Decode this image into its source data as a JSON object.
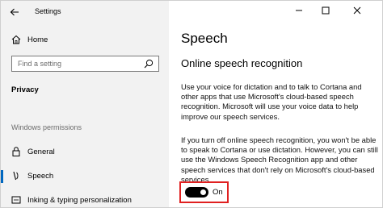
{
  "window": {
    "title": "Settings"
  },
  "sidebar": {
    "home_label": "Home",
    "search_placeholder": "Find a setting",
    "section_title": "Privacy",
    "group_label": "Windows permissions",
    "items": [
      {
        "label": "General",
        "icon": "lock-icon",
        "selected": false
      },
      {
        "label": "Speech",
        "icon": "microphone-icon",
        "selected": true
      },
      {
        "label": "Inking & typing personalization",
        "icon": "pen-icon",
        "selected": false
      }
    ]
  },
  "main": {
    "page_title": "Speech",
    "section_title": "Online speech recognition",
    "paragraph1": "Use your voice for dictation and to talk to Cortana and other apps that use Microsoft's cloud-based speech recognition. Microsoft will use your voice data to help improve our speech services.",
    "paragraph2": "If you turn off online speech recognition, you won't be able to speak to Cortana or use dictation. However, you can still use the Windows Speech Recognition app and other speech services that don't rely on Microsoft's cloud-based services.",
    "toggle": {
      "state_label": "On",
      "on": true
    }
  },
  "colors": {
    "sidebar_bg": "#f2f2f2",
    "accent": "#0067c0",
    "highlight_border": "#e02020",
    "toggle_on": "#000000"
  }
}
